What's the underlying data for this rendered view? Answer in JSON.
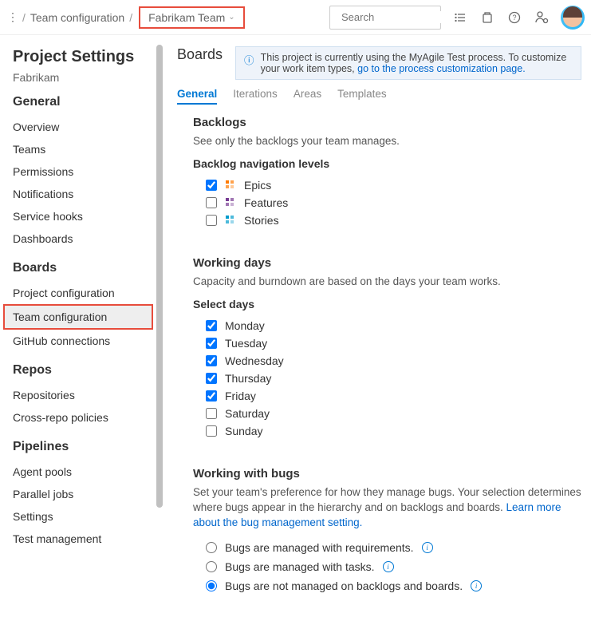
{
  "topbar": {
    "breadcrumb1": "Team configuration",
    "team_name": "Fabrikam Team",
    "search_placeholder": "Search"
  },
  "sidebar": {
    "title": "Project Settings",
    "project": "Fabrikam",
    "sections": {
      "general": {
        "head": "General",
        "items": [
          "Overview",
          "Teams",
          "Permissions",
          "Notifications",
          "Service hooks",
          "Dashboards"
        ]
      },
      "boards": {
        "head": "Boards",
        "items": [
          "Project configuration",
          "Team configuration",
          "GitHub connections"
        ]
      },
      "repos": {
        "head": "Repos",
        "items": [
          "Repositories",
          "Cross-repo policies"
        ]
      },
      "pipelines": {
        "head": "Pipelines",
        "items": [
          "Agent pools",
          "Parallel jobs",
          "Settings",
          "Test management"
        ]
      }
    }
  },
  "main": {
    "heading": "Boards",
    "info_text": "This project is currently using the MyAgile Test process. To customize your work item types, ",
    "info_link": "go to the process customization page.",
    "tabs": [
      "General",
      "Iterations",
      "Areas",
      "Templates"
    ],
    "backlogs": {
      "title": "Backlogs",
      "desc": "See only the backlogs your team manages.",
      "subhead": "Backlog navigation levels",
      "levels": [
        {
          "label": "Epics",
          "checked": true,
          "color": "#ff7b00"
        },
        {
          "label": "Features",
          "checked": false,
          "color": "#773b93"
        },
        {
          "label": "Stories",
          "checked": false,
          "color": "#009ccc"
        }
      ]
    },
    "working_days": {
      "title": "Working days",
      "desc": "Capacity and burndown are based on the days your team works.",
      "subhead": "Select days",
      "days": [
        {
          "label": "Monday",
          "checked": true
        },
        {
          "label": "Tuesday",
          "checked": true
        },
        {
          "label": "Wednesday",
          "checked": true
        },
        {
          "label": "Thursday",
          "checked": true
        },
        {
          "label": "Friday",
          "checked": true
        },
        {
          "label": "Saturday",
          "checked": false
        },
        {
          "label": "Sunday",
          "checked": false
        }
      ]
    },
    "bugs": {
      "title": "Working with bugs",
      "desc": "Set your team's preference for how they manage bugs. Your selection determines where bugs appear in the hierarchy and on backlogs and boards. ",
      "link": "Learn more about the bug management setting.",
      "options": [
        {
          "label": "Bugs are managed with requirements.",
          "selected": false
        },
        {
          "label": "Bugs are managed with tasks.",
          "selected": false
        },
        {
          "label": "Bugs are not managed on backlogs and boards.",
          "selected": true
        }
      ]
    }
  }
}
